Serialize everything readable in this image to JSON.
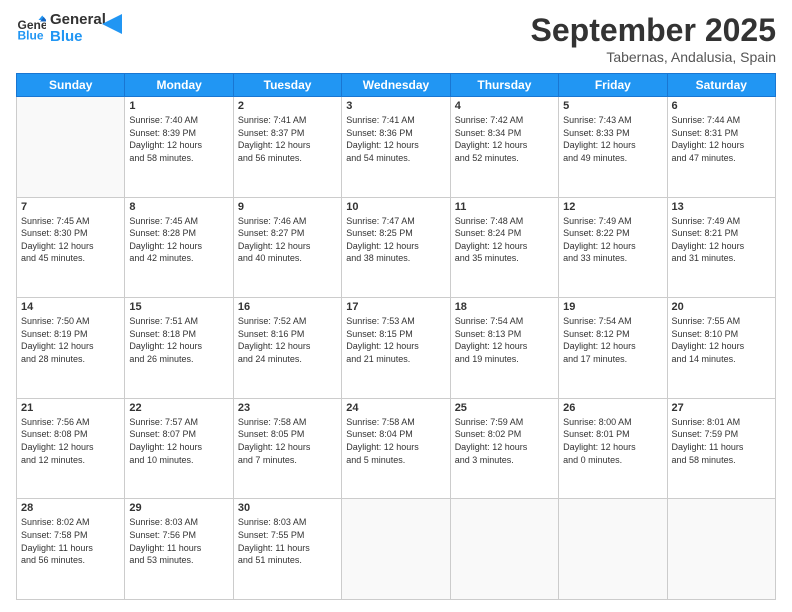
{
  "header": {
    "logo_line1": "General",
    "logo_line2": "Blue",
    "month": "September 2025",
    "location": "Tabernas, Andalusia, Spain"
  },
  "weekdays": [
    "Sunday",
    "Monday",
    "Tuesday",
    "Wednesday",
    "Thursday",
    "Friday",
    "Saturday"
  ],
  "weeks": [
    [
      {
        "day": "",
        "info": ""
      },
      {
        "day": "1",
        "info": "Sunrise: 7:40 AM\nSunset: 8:39 PM\nDaylight: 12 hours\nand 58 minutes."
      },
      {
        "day": "2",
        "info": "Sunrise: 7:41 AM\nSunset: 8:37 PM\nDaylight: 12 hours\nand 56 minutes."
      },
      {
        "day": "3",
        "info": "Sunrise: 7:41 AM\nSunset: 8:36 PM\nDaylight: 12 hours\nand 54 minutes."
      },
      {
        "day": "4",
        "info": "Sunrise: 7:42 AM\nSunset: 8:34 PM\nDaylight: 12 hours\nand 52 minutes."
      },
      {
        "day": "5",
        "info": "Sunrise: 7:43 AM\nSunset: 8:33 PM\nDaylight: 12 hours\nand 49 minutes."
      },
      {
        "day": "6",
        "info": "Sunrise: 7:44 AM\nSunset: 8:31 PM\nDaylight: 12 hours\nand 47 minutes."
      }
    ],
    [
      {
        "day": "7",
        "info": "Sunrise: 7:45 AM\nSunset: 8:30 PM\nDaylight: 12 hours\nand 45 minutes."
      },
      {
        "day": "8",
        "info": "Sunrise: 7:45 AM\nSunset: 8:28 PM\nDaylight: 12 hours\nand 42 minutes."
      },
      {
        "day": "9",
        "info": "Sunrise: 7:46 AM\nSunset: 8:27 PM\nDaylight: 12 hours\nand 40 minutes."
      },
      {
        "day": "10",
        "info": "Sunrise: 7:47 AM\nSunset: 8:25 PM\nDaylight: 12 hours\nand 38 minutes."
      },
      {
        "day": "11",
        "info": "Sunrise: 7:48 AM\nSunset: 8:24 PM\nDaylight: 12 hours\nand 35 minutes."
      },
      {
        "day": "12",
        "info": "Sunrise: 7:49 AM\nSunset: 8:22 PM\nDaylight: 12 hours\nand 33 minutes."
      },
      {
        "day": "13",
        "info": "Sunrise: 7:49 AM\nSunset: 8:21 PM\nDaylight: 12 hours\nand 31 minutes."
      }
    ],
    [
      {
        "day": "14",
        "info": "Sunrise: 7:50 AM\nSunset: 8:19 PM\nDaylight: 12 hours\nand 28 minutes."
      },
      {
        "day": "15",
        "info": "Sunrise: 7:51 AM\nSunset: 8:18 PM\nDaylight: 12 hours\nand 26 minutes."
      },
      {
        "day": "16",
        "info": "Sunrise: 7:52 AM\nSunset: 8:16 PM\nDaylight: 12 hours\nand 24 minutes."
      },
      {
        "day": "17",
        "info": "Sunrise: 7:53 AM\nSunset: 8:15 PM\nDaylight: 12 hours\nand 21 minutes."
      },
      {
        "day": "18",
        "info": "Sunrise: 7:54 AM\nSunset: 8:13 PM\nDaylight: 12 hours\nand 19 minutes."
      },
      {
        "day": "19",
        "info": "Sunrise: 7:54 AM\nSunset: 8:12 PM\nDaylight: 12 hours\nand 17 minutes."
      },
      {
        "day": "20",
        "info": "Sunrise: 7:55 AM\nSunset: 8:10 PM\nDaylight: 12 hours\nand 14 minutes."
      }
    ],
    [
      {
        "day": "21",
        "info": "Sunrise: 7:56 AM\nSunset: 8:08 PM\nDaylight: 12 hours\nand 12 minutes."
      },
      {
        "day": "22",
        "info": "Sunrise: 7:57 AM\nSunset: 8:07 PM\nDaylight: 12 hours\nand 10 minutes."
      },
      {
        "day": "23",
        "info": "Sunrise: 7:58 AM\nSunset: 8:05 PM\nDaylight: 12 hours\nand 7 minutes."
      },
      {
        "day": "24",
        "info": "Sunrise: 7:58 AM\nSunset: 8:04 PM\nDaylight: 12 hours\nand 5 minutes."
      },
      {
        "day": "25",
        "info": "Sunrise: 7:59 AM\nSunset: 8:02 PM\nDaylight: 12 hours\nand 3 minutes."
      },
      {
        "day": "26",
        "info": "Sunrise: 8:00 AM\nSunset: 8:01 PM\nDaylight: 12 hours\nand 0 minutes."
      },
      {
        "day": "27",
        "info": "Sunrise: 8:01 AM\nSunset: 7:59 PM\nDaylight: 11 hours\nand 58 minutes."
      }
    ],
    [
      {
        "day": "28",
        "info": "Sunrise: 8:02 AM\nSunset: 7:58 PM\nDaylight: 11 hours\nand 56 minutes."
      },
      {
        "day": "29",
        "info": "Sunrise: 8:03 AM\nSunset: 7:56 PM\nDaylight: 11 hours\nand 53 minutes."
      },
      {
        "day": "30",
        "info": "Sunrise: 8:03 AM\nSunset: 7:55 PM\nDaylight: 11 hours\nand 51 minutes."
      },
      {
        "day": "",
        "info": ""
      },
      {
        "day": "",
        "info": ""
      },
      {
        "day": "",
        "info": ""
      },
      {
        "day": "",
        "info": ""
      }
    ]
  ]
}
